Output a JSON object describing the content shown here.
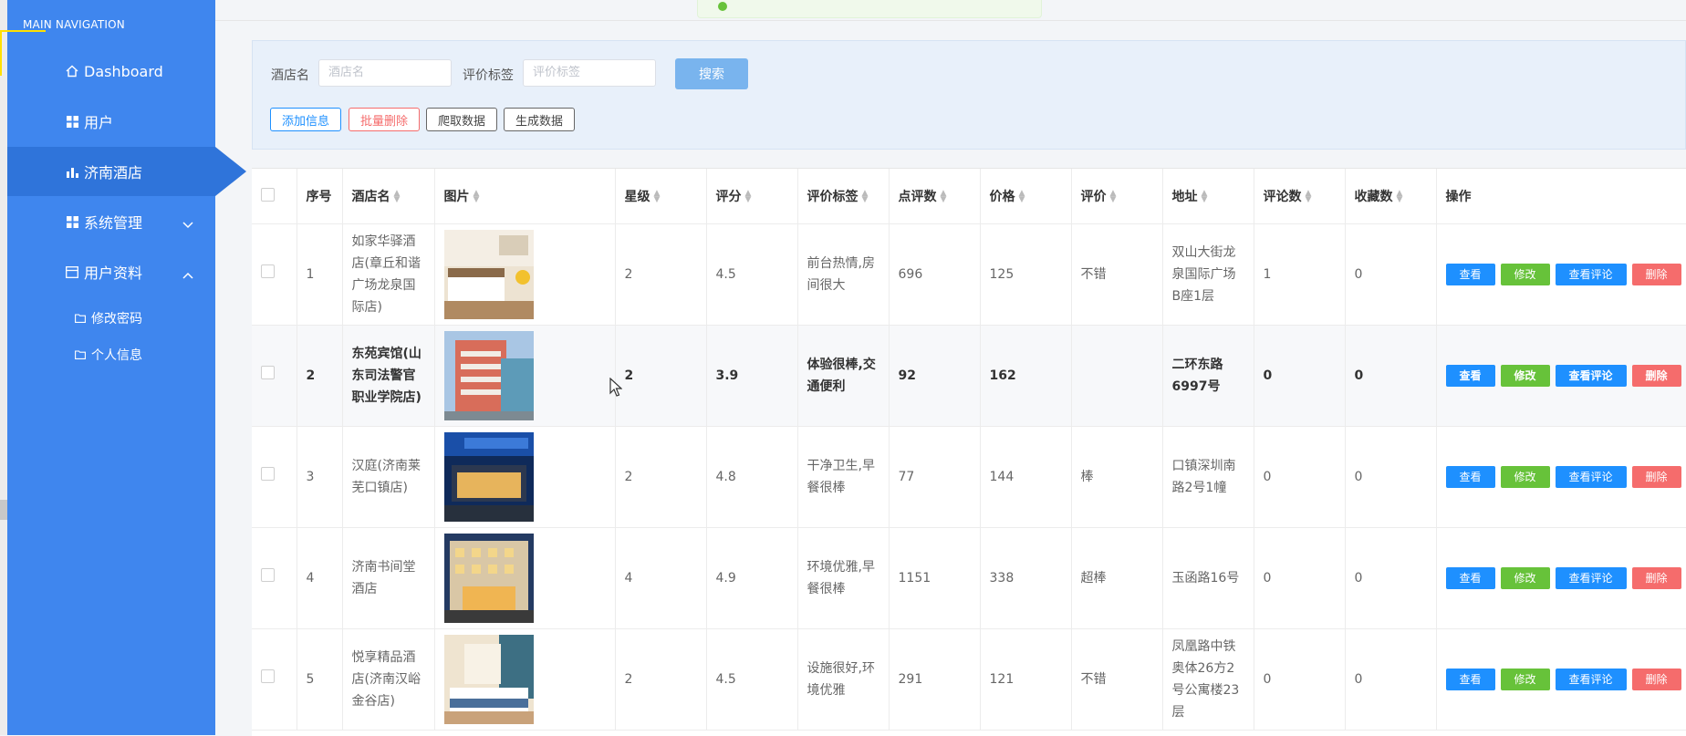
{
  "sidebar": {
    "title": "MAIN NAVIGATION",
    "items": [
      {
        "label": "Dashboard",
        "icon": "home-icon"
      },
      {
        "label": "用户",
        "icon": "grid-icon"
      },
      {
        "label": "济南酒店",
        "icon": "bar-chart-icon"
      },
      {
        "label": "系统管理",
        "icon": "grid-icon"
      },
      {
        "label": "用户资料",
        "icon": "calendar-icon"
      }
    ],
    "sub_items": [
      {
        "label": "修改密码",
        "icon": "folder-icon"
      },
      {
        "label": "个人信息",
        "icon": "folder-icon"
      }
    ]
  },
  "search": {
    "hotel_label": "酒店名",
    "hotel_placeholder": "酒店名",
    "tag_label": "评价标签",
    "tag_placeholder": "评价标签",
    "search_button": "搜索"
  },
  "actions": {
    "add": "添加信息",
    "batch_delete": "批量删除",
    "crawl": "爬取数据",
    "generate": "生成数据"
  },
  "colors": {
    "sidebar": "#3f86ee",
    "active": "#2f74da",
    "view": "#1e90ff",
    "edit": "#67c23a",
    "delete": "#f56c6c",
    "add_border": "#1e90ff",
    "del_border": "#f56c6c"
  },
  "table": {
    "headers": [
      "序号",
      "酒店名",
      "图片",
      "星级",
      "评分",
      "评价标签",
      "点评数",
      "价格",
      "评价",
      "地址",
      "评论数",
      "收藏数",
      "操作"
    ],
    "op_labels": {
      "view": "查看",
      "edit": "修改",
      "comments": "查看评论",
      "delete": "删除"
    },
    "rows": [
      {
        "no": "1",
        "name": "如家华驿酒店(章丘和谐广场龙泉国际店)",
        "star": "2",
        "score": "4.5",
        "tags": "前台热情,房间很大",
        "reviews": "696",
        "price": "125",
        "rating": "不错",
        "address": "双山大街龙泉国际广场B座1层",
        "comments": "1",
        "favorites": "0"
      },
      {
        "no": "2",
        "name": "东苑宾馆(山东司法警官职业学院店)",
        "star": "2",
        "score": "3.9",
        "tags": "体验很棒,交通便利",
        "reviews": "92",
        "price": "162",
        "rating": "",
        "address": "二环东路6997号",
        "comments": "0",
        "favorites": "0"
      },
      {
        "no": "3",
        "name": "汉庭(济南莱芜口镇店)",
        "star": "2",
        "score": "4.8",
        "tags": "干净卫生,早餐很棒",
        "reviews": "77",
        "price": "144",
        "rating": "棒",
        "address": "口镇深圳南路2号1幢",
        "comments": "0",
        "favorites": "0"
      },
      {
        "no": "4",
        "name": "济南书间堂酒店",
        "star": "4",
        "score": "4.9",
        "tags": "环境优雅,早餐很棒",
        "reviews": "1151",
        "price": "338",
        "rating": "超棒",
        "address": "玉函路16号",
        "comments": "0",
        "favorites": "0"
      },
      {
        "no": "5",
        "name": "悦享精品酒店(济南汉峪金谷店)",
        "star": "2",
        "score": "4.5",
        "tags": "设施很好,环境优雅",
        "reviews": "291",
        "price": "121",
        "rating": "不错",
        "address": "凤凰路中铁奥体26方2号公寓楼23层",
        "comments": "0",
        "favorites": "0"
      }
    ]
  }
}
